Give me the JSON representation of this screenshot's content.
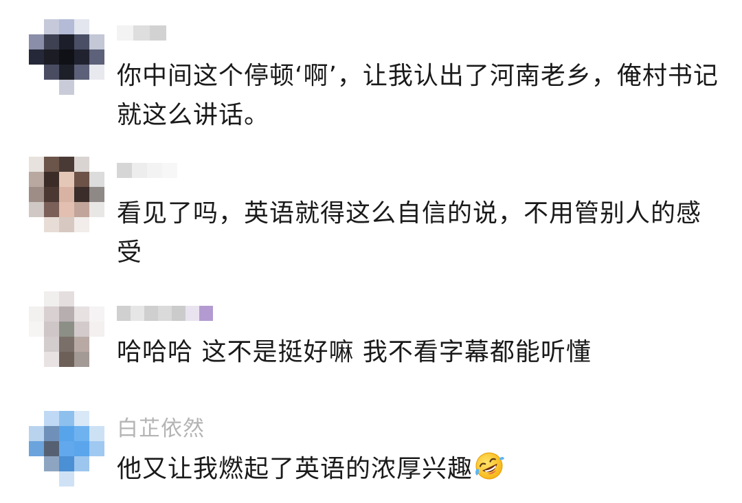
{
  "comments": [
    {
      "username": "",
      "text": "你中间这个停顿‘啊’，让我认出了河南老乡，俺村书记就这么讲话。"
    },
    {
      "username": "",
      "text": "看见了吗，英语就得这么自信的说，不用管别人的感受"
    },
    {
      "username": "",
      "text": "哈哈哈 这不是挺好嘛 我不看字幕都能听懂"
    },
    {
      "username": "白芷依然",
      "text": "他又让我燃起了英语的浓厚兴趣",
      "emoji": "rolling-on-floor-laughing"
    }
  ]
}
